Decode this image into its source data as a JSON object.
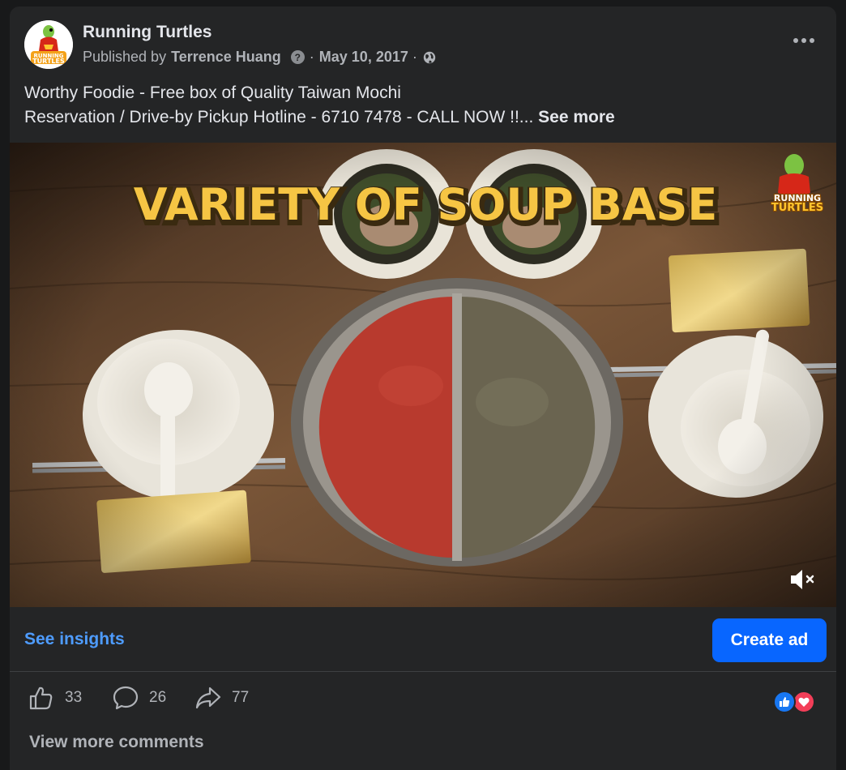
{
  "post": {
    "page_name": "Running Turtles",
    "published_by_label": "Published by",
    "author": "Terrence Huang",
    "date": "May 10, 2017",
    "separator": "·",
    "text_line1": "Worthy Foodie - Free box of Quality Taiwan Mochi",
    "text_line2": "Reservation / Drive-by Pickup Hotline - 6710 7478 - CALL NOW !!...",
    "see_more": "See more"
  },
  "icons": {
    "more": "more-options-icon",
    "privacy": "globe-icon",
    "help": "question-icon",
    "mute": "muted-speaker-icon",
    "like": "thumbs-up-icon",
    "comment": "comment-bubble-icon",
    "share": "share-arrow-icon"
  },
  "video": {
    "overlay_title": "VARIETY OF SOUP BASE",
    "watermark_line1": "RUNNING",
    "watermark_line2": "TURTLES"
  },
  "logo": {
    "line1": "RUNNING",
    "line2": "TURTLES"
  },
  "actions": {
    "see_insights": "See insights",
    "create_ad": "Create ad"
  },
  "stats": {
    "likes": "33",
    "comments": "26",
    "shares": "77"
  },
  "reactions": [
    "like",
    "love"
  ],
  "comments_section": {
    "view_more": "View more comments"
  },
  "colors": {
    "card_bg": "#242526",
    "accent_link": "#4e9cff",
    "primary_button": "#0866ff",
    "like_blue": "#1877f2",
    "love_red": "#f33e58",
    "title_yellow": "#f6c544"
  }
}
